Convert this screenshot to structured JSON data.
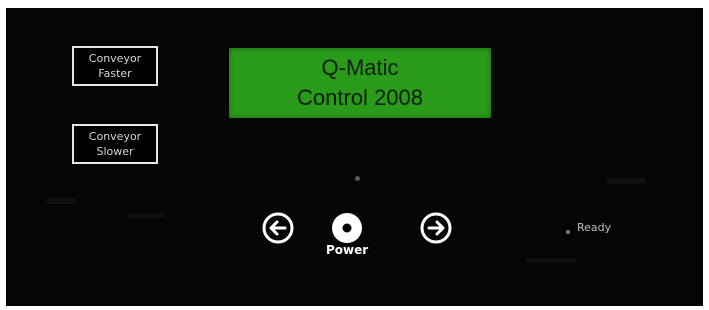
{
  "controls": {
    "conveyor_faster": {
      "line1": "Conveyor",
      "line2": "Faster"
    },
    "conveyor_slower": {
      "line1": "Conveyor",
      "line2": "Slower"
    }
  },
  "display": {
    "line1": "Q-Matic",
    "line2": "Control 2008",
    "color": "#2a9a1a"
  },
  "nav": {
    "left_icon": "arrow-left-icon",
    "right_icon": "arrow-right-icon",
    "power_icon": "power-icon",
    "power_label": "Power"
  },
  "status": {
    "ready_label": "Ready"
  }
}
